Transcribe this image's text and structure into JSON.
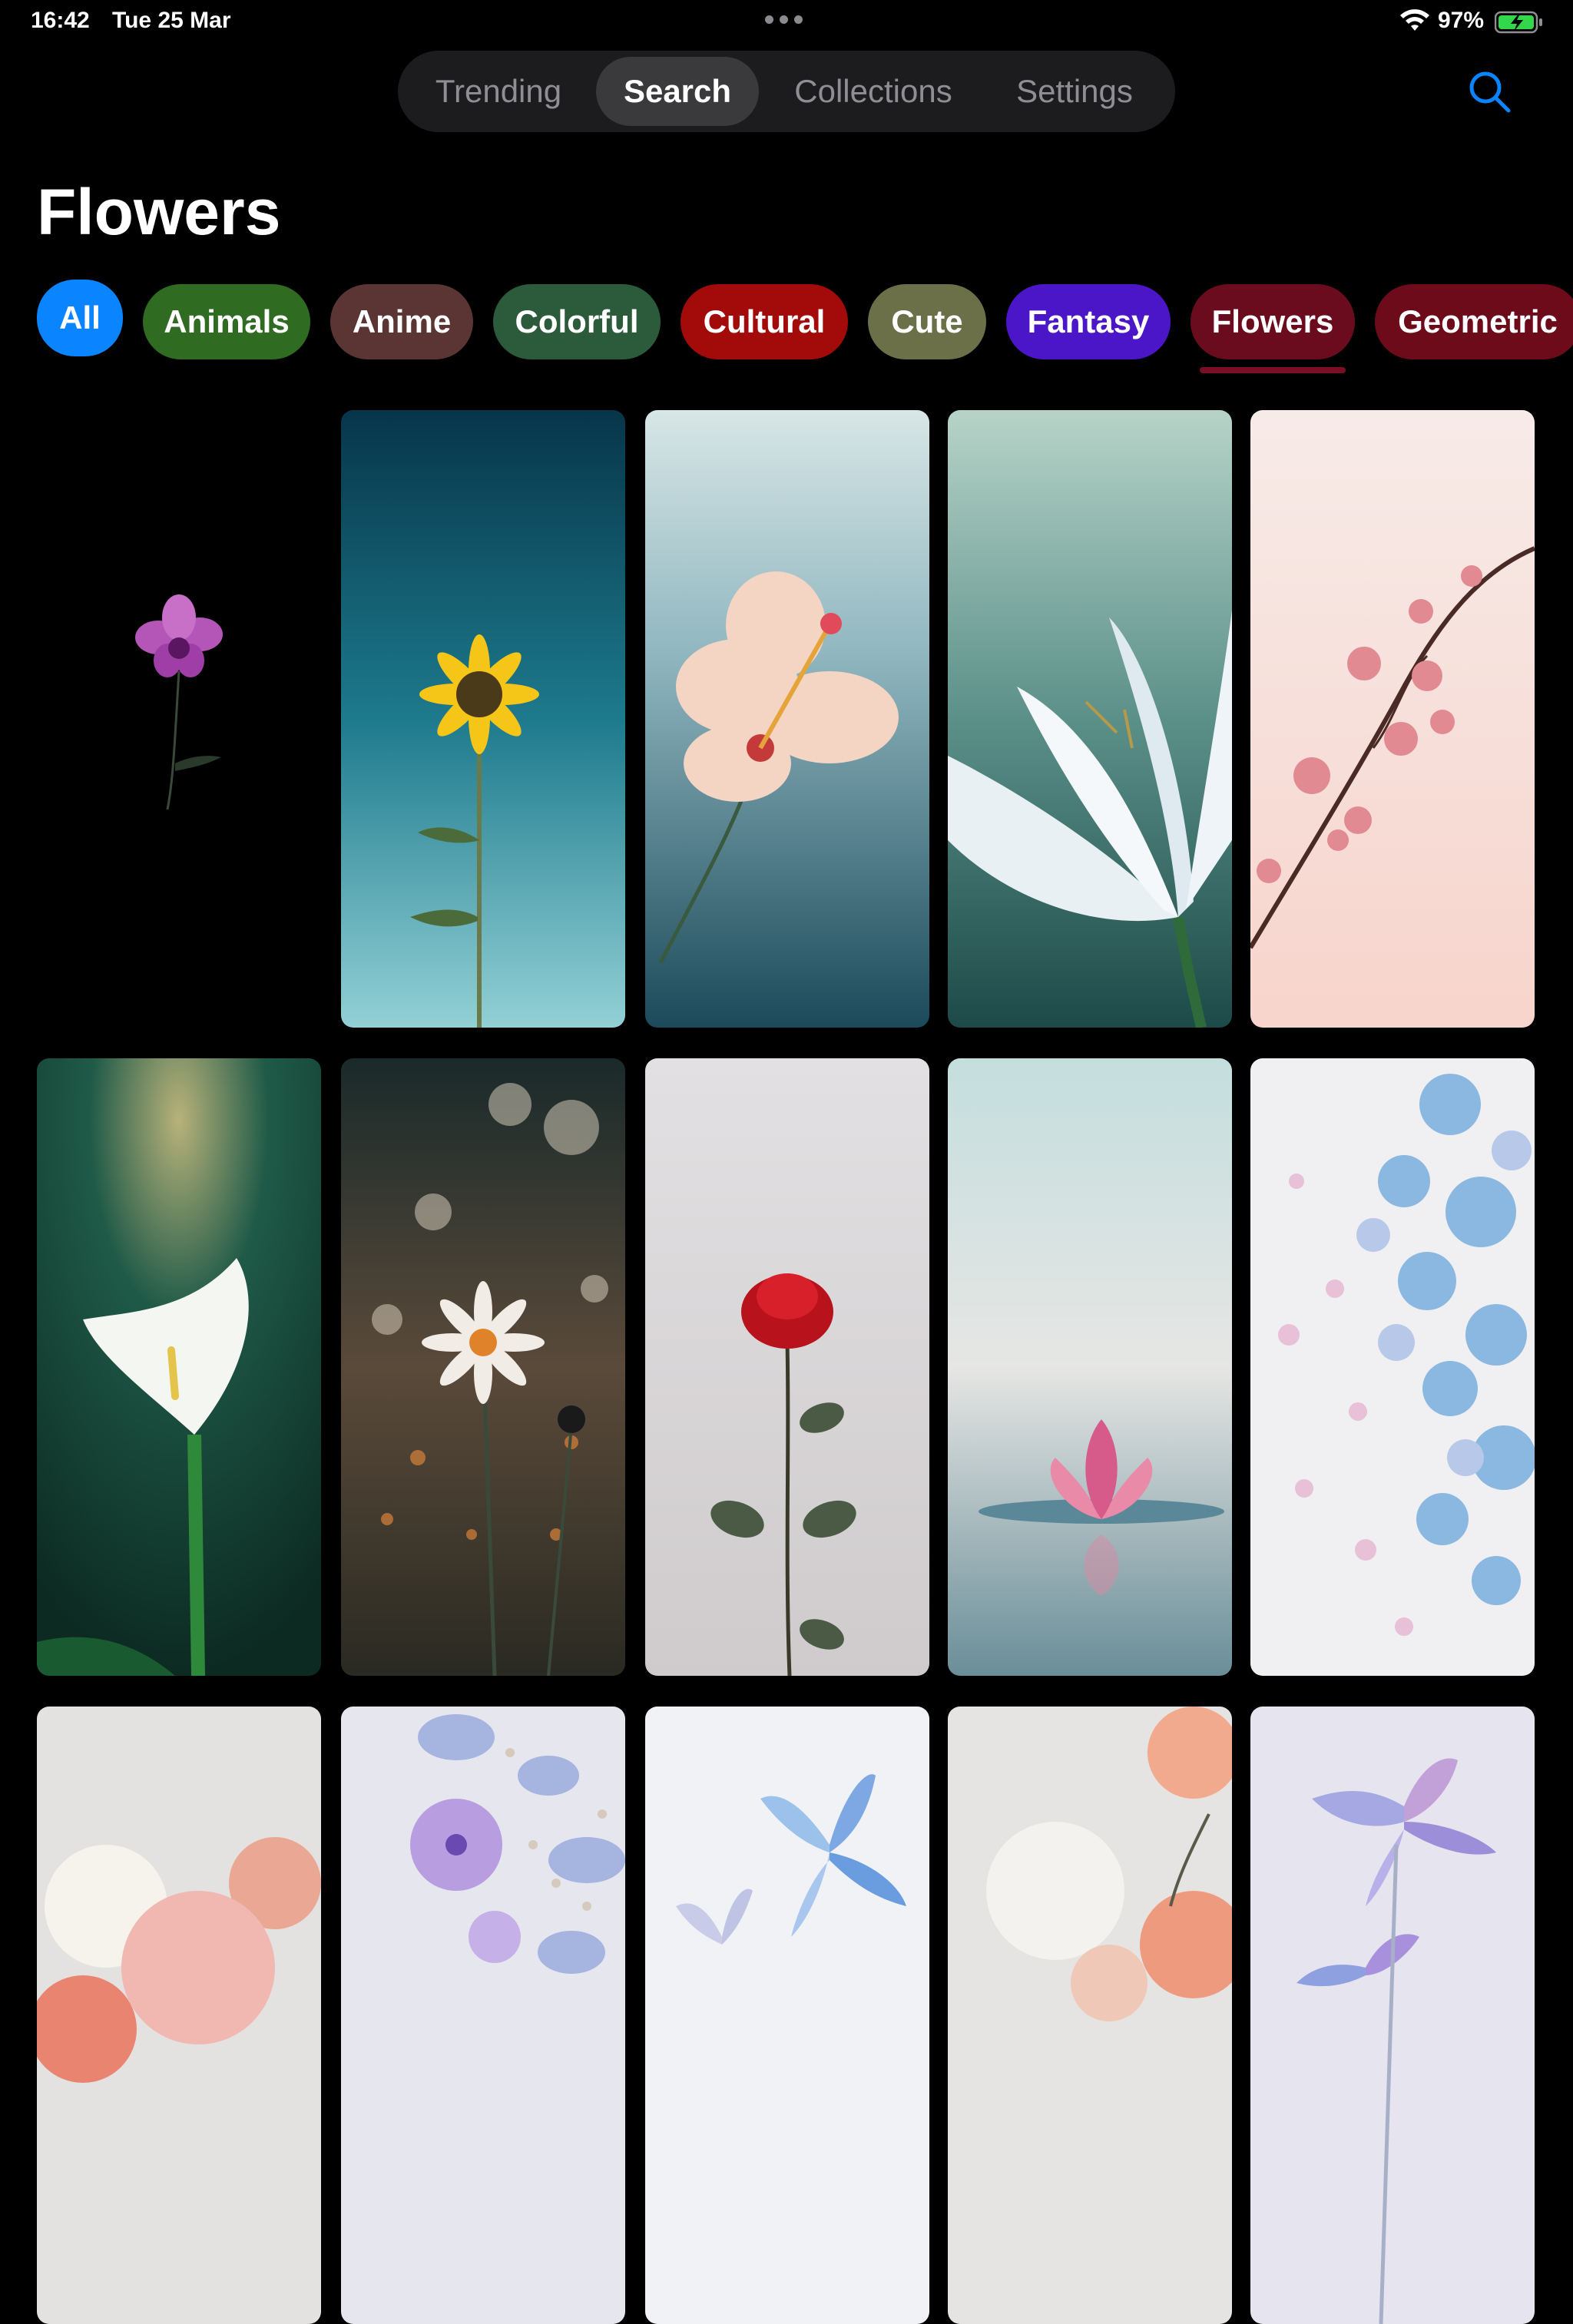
{
  "status_bar": {
    "time": "16:42",
    "date": "Tue 25 Mar",
    "battery_percent": "97%",
    "icons": [
      "wifi-icon",
      "battery-charging-icon",
      "more-dots-icon"
    ]
  },
  "nav": {
    "tabs": [
      {
        "label": "Trending",
        "active": false
      },
      {
        "label": "Search",
        "active": true
      },
      {
        "label": "Collections",
        "active": false
      },
      {
        "label": "Settings",
        "active": false
      }
    ],
    "search_icon": "search-icon",
    "accent_color": "#0a84ff"
  },
  "page": {
    "title": "Flowers"
  },
  "categories": {
    "selected": "Flowers",
    "items": [
      {
        "label": "All",
        "color": "#0a84ff"
      },
      {
        "label": "Animals",
        "color": "#2f6b21"
      },
      {
        "label": "Anime",
        "color": "#5a3533"
      },
      {
        "label": "Colorful",
        "color": "#2c5b3b"
      },
      {
        "label": "Cultural",
        "color": "#a30a0a"
      },
      {
        "label": "Cute",
        "color": "#6b7049"
      },
      {
        "label": "Fantasy",
        "color": "#4b16c8"
      },
      {
        "label": "Flowers",
        "color": "#6b0c1e"
      },
      {
        "label": "Geometric",
        "color": "#6d0b1a"
      }
    ]
  },
  "wallpapers": [
    "purple-orchid",
    "sunflower",
    "hibiscus",
    "white-lily",
    "cherry-blossom",
    "calla-lily",
    "daisy",
    "red-rose",
    "lotus",
    "blue-hydrangea",
    "peonies",
    "violet-blossoms",
    "blue-lilies",
    "white-peach-peonies",
    "iridescent-lilies"
  ]
}
